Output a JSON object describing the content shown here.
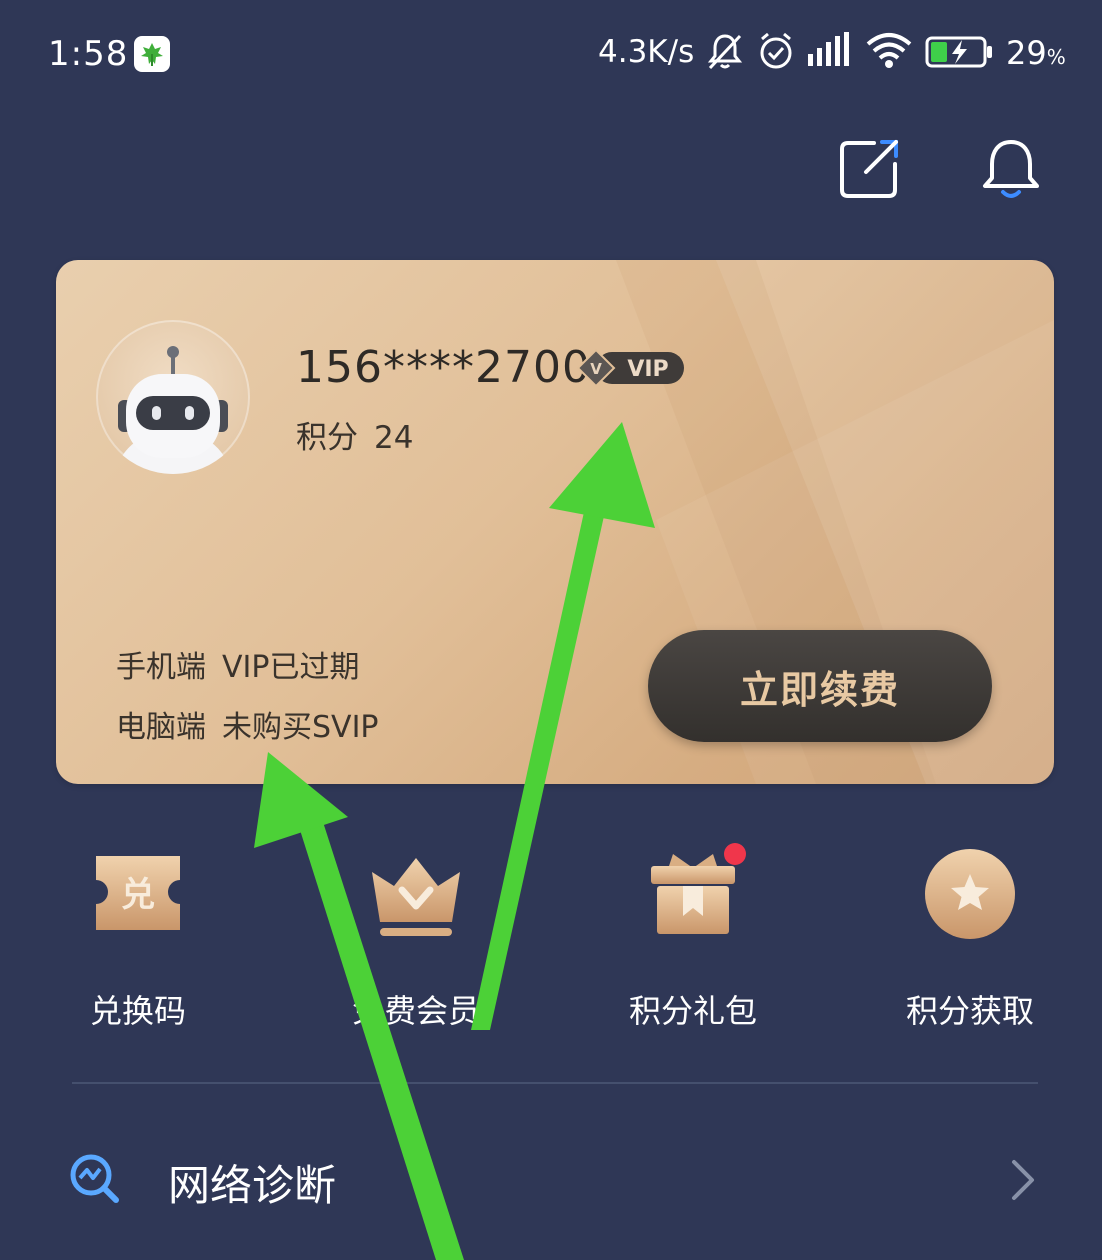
{
  "status_bar": {
    "time": "1:58",
    "network_speed": "4.3K/s",
    "battery_percent": "29",
    "battery_unit": "%",
    "icons": [
      "app-leaf-icon",
      "mute-bell-icon",
      "alarm-icon",
      "signal-icon",
      "wifi-icon",
      "battery-charging-icon"
    ]
  },
  "header": {
    "icons": [
      "edit-share-icon",
      "notification-bell-icon"
    ]
  },
  "vip_card": {
    "phone": "156****2700",
    "vip_badge": "VIP",
    "vip_badge_letter": "V",
    "points_label": "积分",
    "points_value": "24",
    "mobile_label": "手机端",
    "mobile_status": "VIP已过期",
    "pc_label": "电脑端",
    "pc_status": "未购买SVIP",
    "renew_button": "立即续费"
  },
  "quick_actions": [
    {
      "label": "兑换码",
      "icon": "redeem-ticket-icon",
      "glyph": "兑"
    },
    {
      "label": "免费会员",
      "icon": "crown-icon"
    },
    {
      "label": "积分礼包",
      "icon": "gift-box-icon"
    },
    {
      "label": "积分获取",
      "icon": "star-coin-icon"
    }
  ],
  "menu": {
    "network_diagnosis": "网络诊断"
  },
  "colors": {
    "background": "#2f3756",
    "card_gold": "#e1bf98",
    "button_dark": "#3a3735",
    "button_text": "#e8c9a3",
    "annotation_arrow": "#4cd137",
    "badge_red": "#f0364b"
  }
}
